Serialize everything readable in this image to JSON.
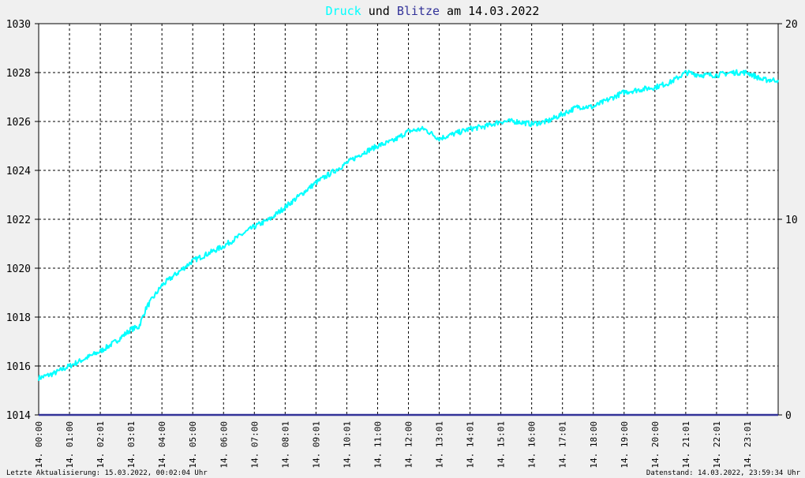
{
  "title": {
    "part1": "Druck",
    "part2": " und ",
    "part3": "Blitze",
    "part4": " am 14.03.2022"
  },
  "colors": {
    "pressure": "#00ffff",
    "lightning": "#333399",
    "text": "#000000",
    "grid": "#000000",
    "background": "#f0f0f0",
    "plot_background": "#ffffff"
  },
  "footer": {
    "left": "Letzte Aktualisierung: 15.03.2022, 00:02:04 Uhr",
    "right": "Datenstand: 14.03.2022, 23:59:34 Uhr"
  },
  "chart_data": {
    "type": "line",
    "title": "Druck und Blitze am 14.03.2022",
    "x_tick_labels": [
      "14. 00:00",
      "14. 01:00",
      "14. 02:01",
      "14. 03:01",
      "14. 04:00",
      "14. 05:00",
      "14. 06:00",
      "14. 07:00",
      "14. 08:01",
      "14. 09:01",
      "14. 10:01",
      "14. 11:00",
      "14. 12:00",
      "14. 13:01",
      "14. 14:01",
      "14. 15:01",
      "14. 16:00",
      "14. 17:01",
      "14. 18:00",
      "14. 19:00",
      "14. 20:00",
      "14. 21:01",
      "14. 22:01",
      "14. 23:01"
    ],
    "x_range_hours": [
      0,
      24
    ],
    "y_left": {
      "range": [
        1014,
        1030
      ],
      "ticks": [
        1014,
        1016,
        1018,
        1020,
        1022,
        1024,
        1026,
        1028,
        1030
      ]
    },
    "y_right": {
      "range": [
        0,
        20
      ],
      "ticks": [
        0,
        10,
        20
      ]
    },
    "grid": true,
    "series": [
      {
        "name": "Druck",
        "axis": "left",
        "x_hours": [
          0,
          0.5,
          1,
          1.5,
          2,
          2.5,
          3,
          3.25,
          3.5,
          4,
          4.5,
          5,
          5.5,
          6,
          6.5,
          7,
          7.5,
          8,
          8.5,
          9,
          9.5,
          10,
          10.5,
          11,
          11.5,
          12,
          12.5,
          13,
          13.5,
          14,
          14.5,
          15,
          15.5,
          16,
          16.5,
          17,
          17.5,
          18,
          18.5,
          19,
          19.5,
          20,
          20.5,
          21,
          21.5,
          22,
          22.5,
          23,
          23.5,
          24
        ],
        "values": [
          1015.5,
          1015.7,
          1016.0,
          1016.3,
          1016.6,
          1017.0,
          1017.5,
          1017.6,
          1018.4,
          1019.3,
          1019.8,
          1020.3,
          1020.6,
          1020.9,
          1021.3,
          1021.7,
          1022.0,
          1022.5,
          1023.0,
          1023.5,
          1023.9,
          1024.3,
          1024.7,
          1025.0,
          1025.2,
          1025.6,
          1025.7,
          1025.3,
          1025.5,
          1025.7,
          1025.8,
          1026.0,
          1026.0,
          1025.9,
          1026.0,
          1026.3,
          1026.6,
          1026.6,
          1026.9,
          1027.2,
          1027.3,
          1027.4,
          1027.6,
          1028.0,
          1027.9,
          1027.9,
          1028.0,
          1028.0,
          1027.7,
          1027.7
        ]
      },
      {
        "name": "Blitze",
        "axis": "right",
        "x_hours": [
          0,
          24
        ],
        "values": [
          0,
          0
        ]
      }
    ]
  }
}
